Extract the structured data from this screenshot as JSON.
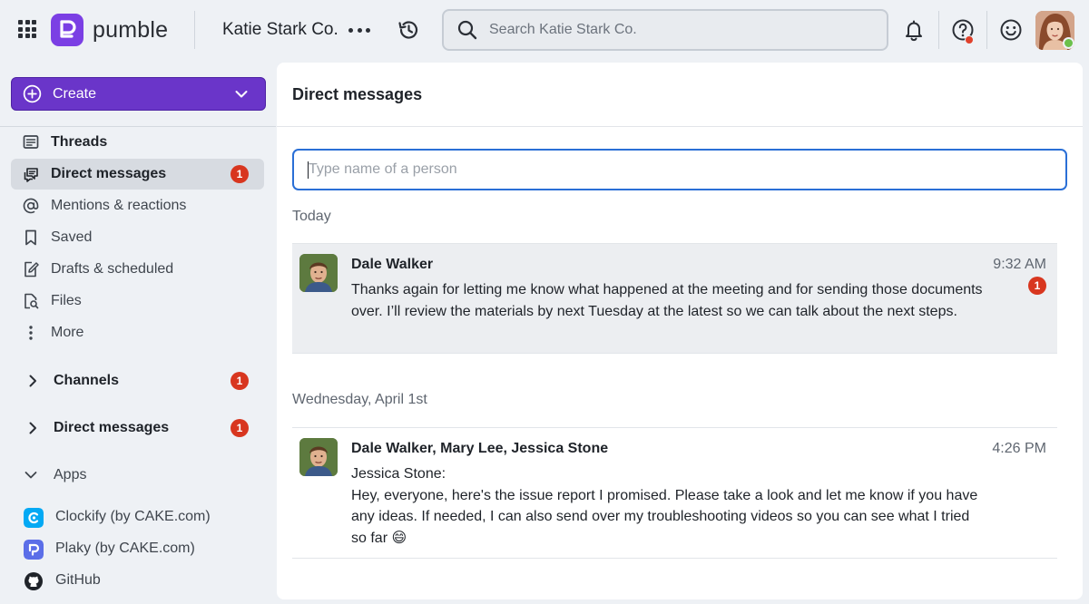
{
  "header": {
    "logo_text": "pumble",
    "workspace_name": "Katie Stark Co.",
    "search_placeholder": "Search Katie Stark Co."
  },
  "sidebar": {
    "create_label": "Create",
    "items": [
      {
        "label": "Threads"
      },
      {
        "label": "Direct messages",
        "badge": "1"
      },
      {
        "label": "Mentions & reactions"
      },
      {
        "label": "Saved"
      },
      {
        "label": "Drafts & scheduled"
      },
      {
        "label": "Files"
      },
      {
        "label": "More"
      }
    ],
    "sections": [
      {
        "label": "Channels",
        "badge": "1"
      },
      {
        "label": "Direct messages",
        "badge": "1"
      },
      {
        "label": "Apps"
      }
    ],
    "apps": [
      {
        "label": "Clockify (by CAKE.com)"
      },
      {
        "label": "Plaky (by CAKE.com)"
      },
      {
        "label": "GitHub"
      }
    ]
  },
  "main": {
    "title": "Direct messages",
    "input_placeholder": "Type name of a person",
    "groups": [
      {
        "day": "Today",
        "conversations": [
          {
            "name": "Dale Walker",
            "time": "9:32 AM",
            "badge": "1",
            "text": "Thanks again for letting me know what happened at the meeting and for sending those documents over. I’ll review the materials by next Tuesday at the latest so we can talk about the next steps."
          }
        ]
      },
      {
        "day": "Wednesday, April 1st",
        "conversations": [
          {
            "name": "Dale Walker, Mary Lee, Jessica Stone",
            "time": "4:26 PM",
            "sender": "Jessica Stone:",
            "text": "Hey, everyone, here's the issue report I promised. Please take a look and let me know if you have any ideas. If needed, I can also send over my troubleshooting videos so you can see what I tried so far",
            "emoji": "😄"
          }
        ]
      }
    ]
  },
  "colors": {
    "brand": "#7b3fe4",
    "create_button": "#6a35c9",
    "badge": "#d8361f",
    "input_focus": "#2a6fd6",
    "online": "#6bc04b"
  },
  "icons": {
    "apps": "apps-grid-icon",
    "history": "history-icon",
    "search": "search-icon",
    "notifications": "bell-icon",
    "help": "help-icon",
    "status": "smiley-icon"
  }
}
